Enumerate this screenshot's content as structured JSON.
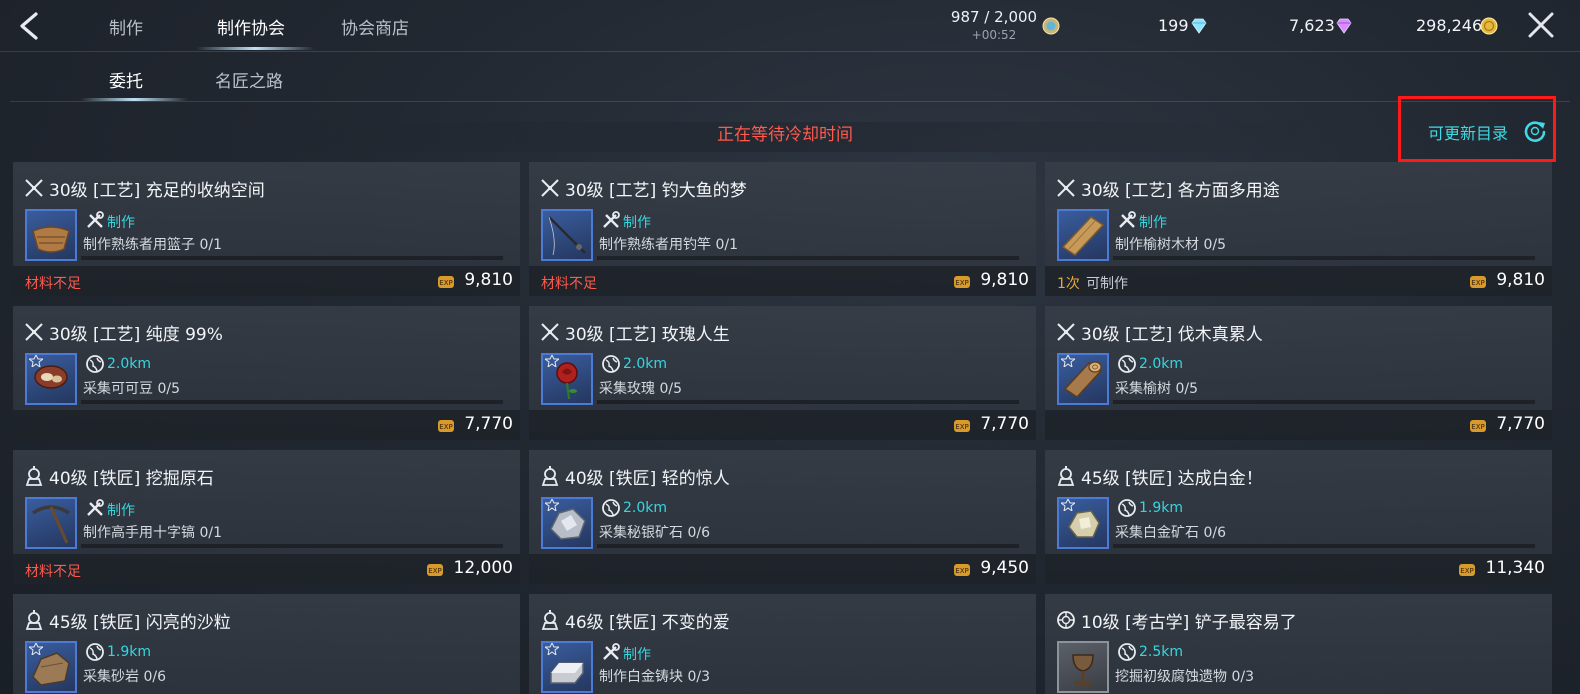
{
  "header": {
    "tabs": [
      {
        "label": "制作",
        "active": false
      },
      {
        "label": "制作协会",
        "active": true
      },
      {
        "label": "协会商店",
        "active": false
      }
    ],
    "stamina": {
      "value": "987 / 2,000",
      "timer": "+00:52"
    },
    "currencies": [
      {
        "value": "199",
        "icon": "diamond-blue-icon"
      },
      {
        "value": "7,623",
        "icon": "diamond-purple-icon"
      },
      {
        "value": "298,246",
        "icon": "gold-coin-icon"
      }
    ]
  },
  "subtabs": [
    {
      "label": "委托",
      "active": true
    },
    {
      "label": "名匠之路",
      "active": false
    }
  ],
  "cooldown_text": "正在等待冷却时间",
  "refresh": {
    "label": "可更新目录"
  },
  "colors": {
    "accent_cyan": "#34d7e0",
    "warn_red": "#ff5a4c",
    "highlight_box": "#ff1a1a",
    "count_orange": "#e7a93e"
  },
  "cards": [
    {
      "type": "craft",
      "title": "30级 [工艺] 充足的收纳空间",
      "method": "制作",
      "method_icon": "tools-icon",
      "task": "制作熟练者用篮子 0/1",
      "status": "材料不足",
      "count": "",
      "status_ok": "",
      "exp": "9,810",
      "item": "basket-icon",
      "thumb": "blue"
    },
    {
      "type": "craft",
      "title": "30级 [工艺] 钓大鱼的梦",
      "method": "制作",
      "method_icon": "tools-icon",
      "task": "制作熟练者用钓竿 0/1",
      "status": "材料不足",
      "count": "",
      "status_ok": "",
      "exp": "9,810",
      "item": "fishing-rod-icon",
      "thumb": "blue"
    },
    {
      "type": "craft",
      "title": "30级 [工艺] 各方面多用途",
      "method": "制作",
      "method_icon": "tools-icon",
      "task": "制作榆树木材 0/5",
      "status": "",
      "count": "1次",
      "status_ok": "可制作",
      "exp": "9,810",
      "item": "lumber-icon",
      "thumb": "blue"
    },
    {
      "type": "craft",
      "title": "30级 [工艺] 纯度 99%",
      "method": "2.0km",
      "method_icon": "globe-icon",
      "task": "采集可可豆 0/5",
      "status": "",
      "count": "",
      "status_ok": "",
      "exp": "7,770",
      "item": "cocoa-bean-icon",
      "thumb": "blue"
    },
    {
      "type": "craft",
      "title": "30级 [工艺] 玫瑰人生",
      "method": "2.0km",
      "method_icon": "globe-icon",
      "task": "采集玫瑰 0/5",
      "status": "",
      "count": "",
      "status_ok": "",
      "exp": "7,770",
      "item": "rose-icon",
      "thumb": "blue"
    },
    {
      "type": "craft",
      "title": "30级 [工艺] 伐木真累人",
      "method": "2.0km",
      "method_icon": "globe-icon",
      "task": "采集榆树 0/5",
      "status": "",
      "count": "",
      "status_ok": "",
      "exp": "7,770",
      "item": "log-icon",
      "thumb": "blue"
    },
    {
      "type": "smith",
      "title": "40级 [铁匠] 挖掘原石",
      "method": "制作",
      "method_icon": "tools-icon",
      "task": "制作高手用十字镐 0/1",
      "status": "材料不足",
      "count": "",
      "status_ok": "",
      "exp": "12,000",
      "item": "pickaxe-icon",
      "thumb": "blue"
    },
    {
      "type": "smith",
      "title": "40级 [铁匠] 轻的惊人",
      "method": "2.0km",
      "method_icon": "globe-icon",
      "task": "采集秘银矿石 0/6",
      "status": "",
      "count": "",
      "status_ok": "",
      "exp": "9,450",
      "item": "mithril-ore-icon",
      "thumb": "blue"
    },
    {
      "type": "smith",
      "title": "45级 [铁匠] 达成白金！",
      "method": "1.9km",
      "method_icon": "globe-icon",
      "task": "采集白金矿石 0/6",
      "status": "",
      "count": "",
      "status_ok": "",
      "exp": "11,340",
      "item": "platinum-ore-icon",
      "thumb": "blue"
    },
    {
      "type": "smith",
      "title": "45级 [铁匠] 闪亮的沙粒",
      "method": "1.9km",
      "method_icon": "globe-icon",
      "task": "采集砂岩 0/6",
      "status": "",
      "count": "",
      "status_ok": "",
      "exp": "",
      "item": "sandstone-icon",
      "thumb": "blue"
    },
    {
      "type": "smith",
      "title": "46级 [铁匠] 不变的爱",
      "method": "制作",
      "method_icon": "tools-icon",
      "task": "制作白金铸块 0/3",
      "status": "",
      "count": "",
      "status_ok": "",
      "exp": "",
      "item": "ingot-icon",
      "thumb": "blue"
    },
    {
      "type": "archaeology",
      "title": "10级 [考古学] 铲子最容易了",
      "method": "2.5km",
      "method_icon": "globe-icon",
      "task": "挖掘初级腐蚀遗物 0/3",
      "status": "",
      "count": "",
      "status_ok": "",
      "exp": "",
      "item": "relic-goblet-icon",
      "thumb": "gray"
    }
  ]
}
